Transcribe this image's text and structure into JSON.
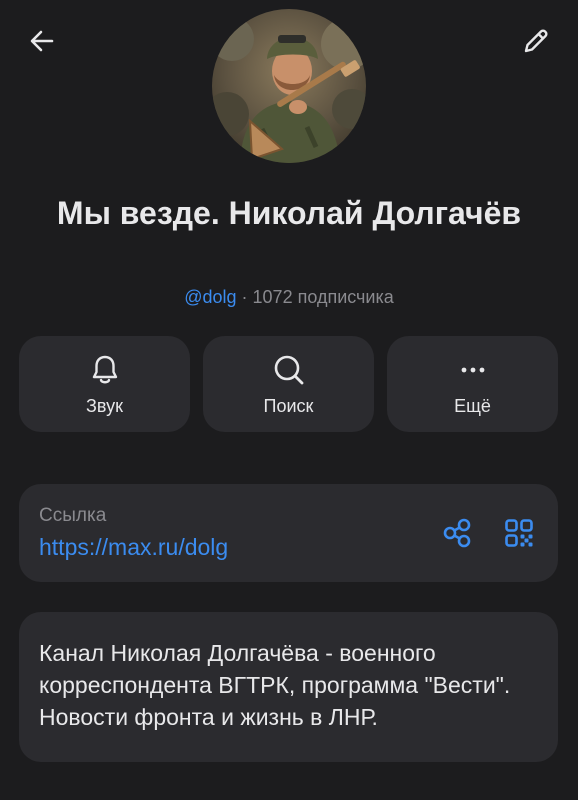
{
  "header": {
    "back_icon": "arrow-left-icon",
    "edit_icon": "pencil-icon"
  },
  "profile": {
    "title": "Мы везде. Николай Долгачёв",
    "handle": "@dolg",
    "separator": " · ",
    "subscribers": "1072 подписчика"
  },
  "actions": [
    {
      "label": "Звук",
      "icon": "bell-icon"
    },
    {
      "label": "Поиск",
      "icon": "search-icon"
    },
    {
      "label": "Ещё",
      "icon": "more-dots-icon"
    }
  ],
  "link": {
    "caption": "Ссылка",
    "url": "https://max.ru/dolg",
    "share_icon": "share-icon",
    "qr_icon": "qr-code-icon"
  },
  "description": {
    "text": "Канал Николая Долгачёва - военного корреспондента ВГТРК, программа \"Вести\".\nНовости фронта и жизнь в ЛНР."
  },
  "colors": {
    "background": "#1c1c1e",
    "card": "#2b2b2f",
    "accent": "#3b8cf0",
    "secondary_text": "#8a8a8f",
    "primary_text": "#e8e8ea"
  }
}
